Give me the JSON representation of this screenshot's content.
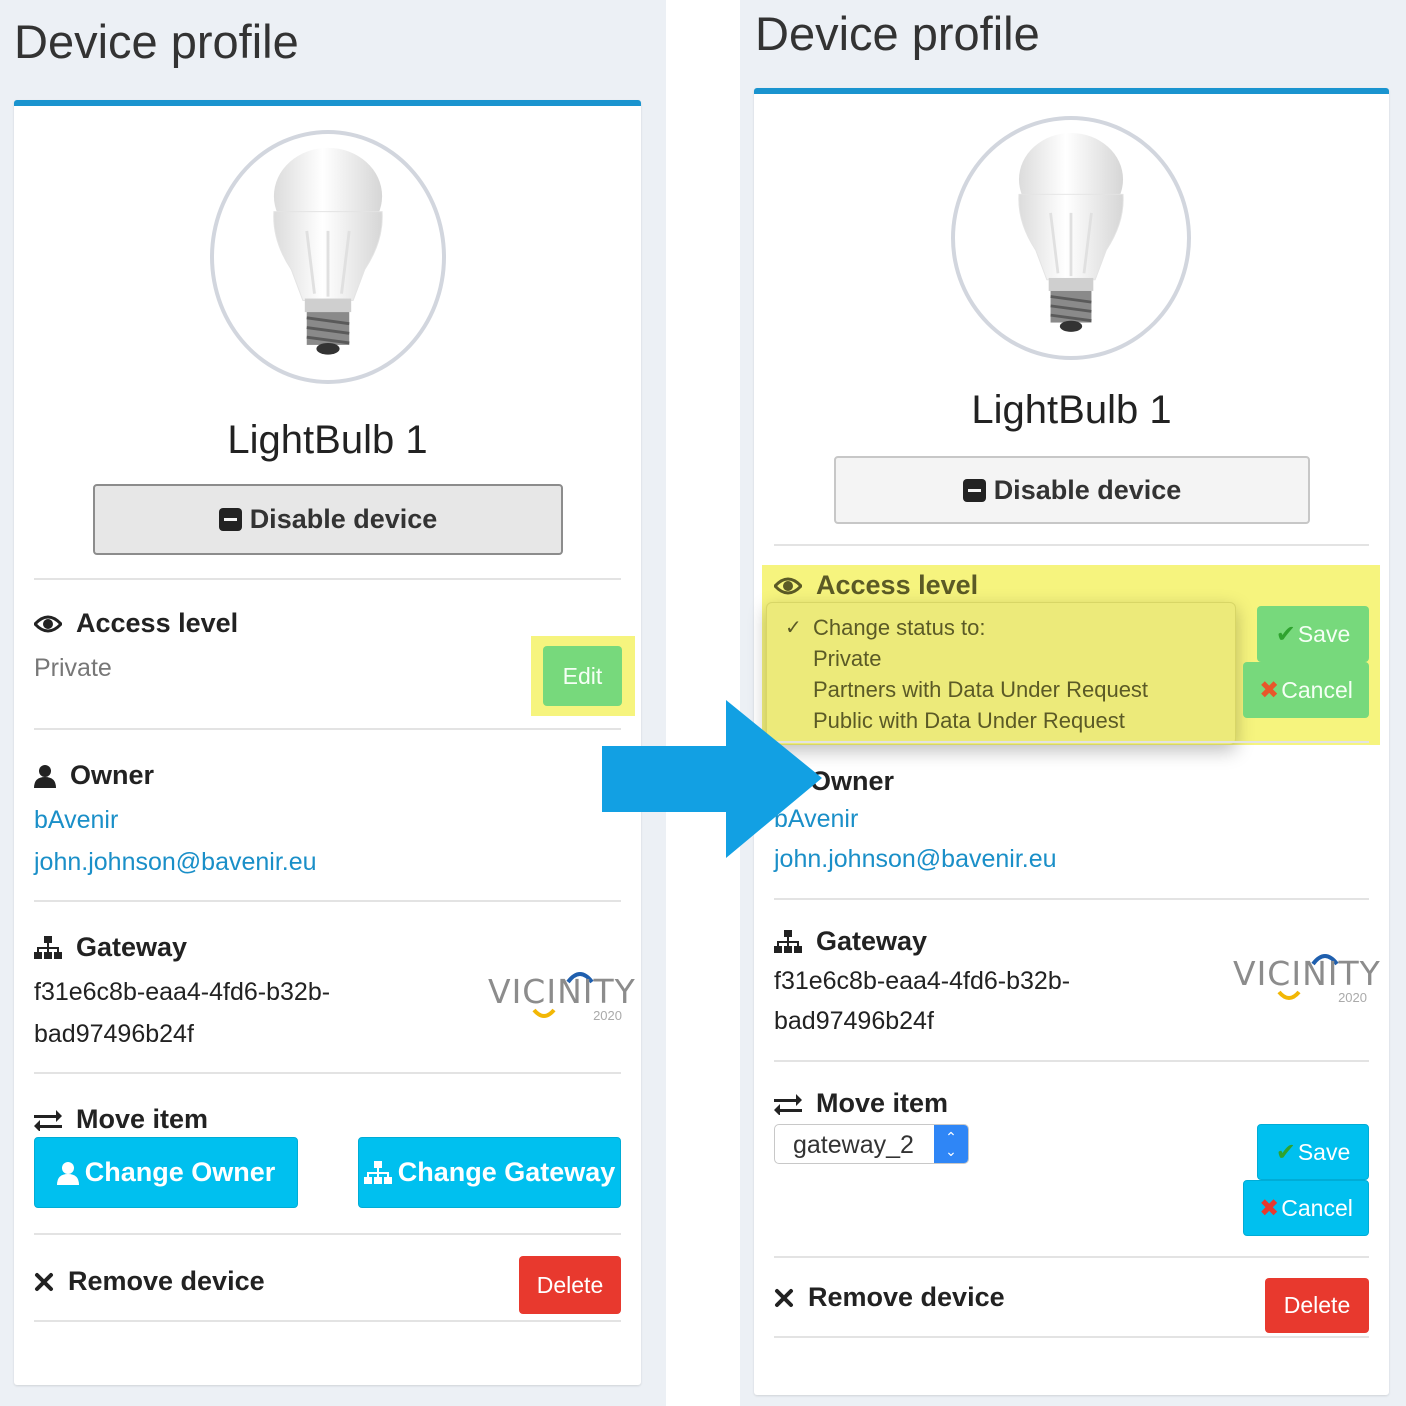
{
  "colors": {
    "accent": "#1a94cf",
    "link": "#1a8fc8",
    "cyan_button": "#00c0ef",
    "green_button": "#77d97c",
    "red_button": "#e8392e",
    "highlight": "#f6f47e",
    "arrow": "#12a0e3"
  },
  "left": {
    "title": "Device profile",
    "device_name": "LightBulb 1",
    "disable_label": "Disable device",
    "access": {
      "title": "Access level",
      "value": "Private",
      "edit_label": "Edit"
    },
    "owner": {
      "title": "Owner",
      "org": "bAvenir",
      "email": "john.johnson@bavenir.eu"
    },
    "gateway": {
      "title": "Gateway",
      "id_line1": "f31e6c8b-eaa4-4fd6-b32b-",
      "id_line2": "bad97496b24f"
    },
    "logo": {
      "text": "VICINITY",
      "year": "2020"
    },
    "move": {
      "title": "Move item",
      "change_owner_label": "Change Owner",
      "change_gateway_label": "Change Gateway"
    },
    "remove": {
      "title": "Remove device",
      "delete_label": "Delete"
    }
  },
  "right": {
    "title": "Device profile",
    "device_name": "LightBulb 1",
    "disable_label": "Disable device",
    "access": {
      "title": "Access level",
      "dropdown_options": [
        "Change status to:",
        "Private",
        "Partners with Data Under Request",
        "Public with Data Under Request"
      ],
      "selected_option": "Change status to:",
      "save_label": "Save",
      "cancel_label": "Cancel"
    },
    "owner": {
      "title": "Owner",
      "org": "bAvenir",
      "email": "john.johnson@bavenir.eu"
    },
    "gateway": {
      "title": "Gateway",
      "id_line1": "f31e6c8b-eaa4-4fd6-b32b-",
      "id_line2": "bad97496b24f"
    },
    "logo": {
      "text": "VICINITY",
      "year": "2020"
    },
    "move": {
      "title": "Move item",
      "select_value": "gateway_2",
      "save_label": "Save",
      "cancel_label": "Cancel"
    },
    "remove": {
      "title": "Remove device",
      "delete_label": "Delete"
    }
  },
  "icons": [
    "eye-icon",
    "user-icon",
    "sitemap-icon",
    "exchange-icon",
    "times-icon",
    "minus-square-icon",
    "check-icon",
    "close-icon"
  ]
}
